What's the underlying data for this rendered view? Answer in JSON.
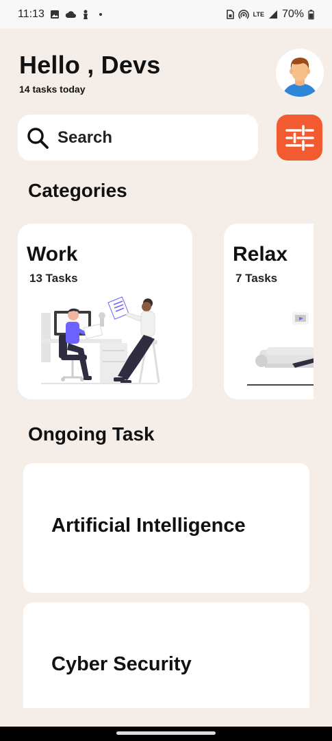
{
  "status_bar": {
    "time": "11:13",
    "lte": "LTE",
    "battery": "70%",
    "icons": [
      "image-icon",
      "cloud-icon",
      "figure-icon",
      "dot-icon",
      "sim-icon",
      "hotspot-icon",
      "signal-icon",
      "battery-icon"
    ]
  },
  "header": {
    "greeting": "Hello , Devs",
    "subtitle": "14 tasks today"
  },
  "search": {
    "placeholder": "Search"
  },
  "categories": {
    "title": "Categories",
    "items": [
      {
        "name": "Work",
        "count": "13 Tasks"
      },
      {
        "name": "Relax",
        "count": "7 Tasks"
      }
    ]
  },
  "ongoing": {
    "title": "Ongoing Task",
    "items": [
      {
        "title": "Artificial Intelligence"
      },
      {
        "title": "Cyber Security"
      }
    ]
  },
  "colors": {
    "background": "#f5ede7",
    "accent": "#f25a2f",
    "card": "#ffffff"
  }
}
